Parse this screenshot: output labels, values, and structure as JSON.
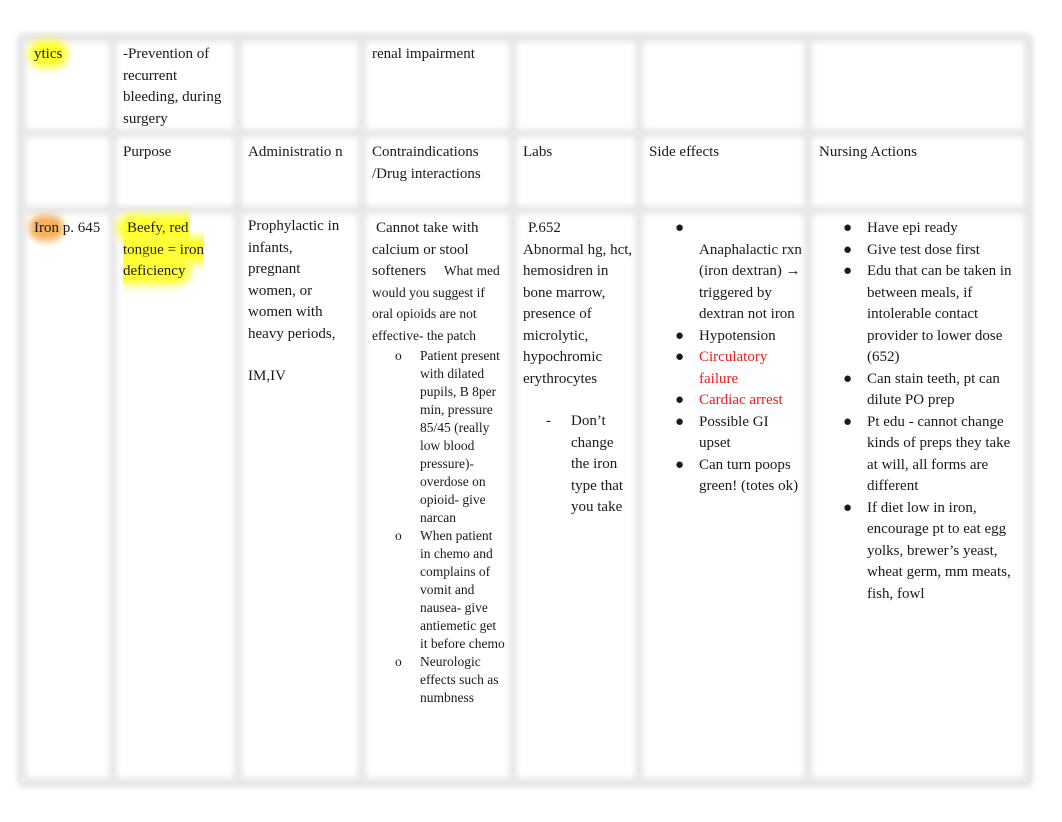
{
  "row_prev": {
    "drug": "ytics",
    "purpose": "-Prevention of recurrent bleeding, during surgery",
    "administration": "",
    "contraindications": "renal impairment",
    "labs": "",
    "side_effects": "",
    "nursing_actions": ""
  },
  "header": {
    "drug": "",
    "purpose": "Purpose",
    "administration": "Administratio n",
    "contraindications": "Contraindications /Drug interactions",
    "labs": "Labs",
    "side_effects": "Side effects",
    "nursing_actions": "Nursing Actions"
  },
  "iron_row": {
    "drug_name": "Iron",
    "drug_page": " p. 645",
    "purpose": "Beefy, red tongue =   iron deficiency",
    "administration": "Prophylactic in infants, pregnant women, or women with heavy periods,",
    "administration_route": "IM,IV",
    "contraindications_intro": "Cannot take with calcium or stool softeners",
    "contraindications_question": "What med would you suggest if oral opioids are not effective- the patch",
    "contraindications_subitems": [
      {
        "marker": "o",
        "text": "Patient present with dilated pupils, B 8per min, pressure 85/45 (really low blood pressure)- overdose on opioid- give narcan"
      },
      {
        "marker": "o",
        "text": "When patient in chemo and complains of vomit and nausea- give antiemetic get it before chemo"
      },
      {
        "marker": "o",
        "text": "Neurologic effects such as numbness"
      }
    ],
    "labs_page": "P.652",
    "labs": "Abnormal hg, hct, hemosidren in bone marrow, presence of microlytic, hypochromic erythrocytes",
    "labs_subitems": [
      {
        "marker": "-",
        "text": "Don’t change the iron type that you take"
      }
    ],
    "side_effects": [
      {
        "marker": "●",
        "text": "",
        "color": "#1a1a1a"
      },
      {
        "marker": "",
        "text": "Anaphalactic rxn (iron dextran) → triggered by dextran not iron",
        "color": "#1a1a1a"
      },
      {
        "marker": "●",
        "text": "Hypotension",
        "color": "#1a1a1a"
      },
      {
        "marker": "●",
        "text": "Circulatory failure",
        "color": "#ee1c1c"
      },
      {
        "marker": "●",
        "text": "Cardiac arrest",
        "color": "#ee1c1c"
      },
      {
        "marker": "●",
        "text": "Possible GI upset",
        "color": "#1a1a1a"
      },
      {
        "marker": "●",
        "text": "Can turn poops green! (totes ok)",
        "color": "#1a1a1a"
      }
    ],
    "nursing_actions": [
      {
        "marker": "●",
        "text": " Have epi ready"
      },
      {
        "marker": "●",
        "text": "Give test dose first"
      },
      {
        "marker": "●",
        "text": "Edu that can be taken in between meals, if intolerable contact provider to lower dose (652)"
      },
      {
        "marker": "●",
        "text": "Can stain teeth, pt can dilute PO prep"
      },
      {
        "marker": "●",
        "text": "Pt edu - cannot change kinds of preps they take at will, all forms are different"
      },
      {
        "marker": "●",
        "text": "If diet low in iron, encourage pt to eat egg yolks, brewer’s yeast, wheat germ, mm meats, fish, fowl"
      }
    ]
  },
  "colors": {
    "highlight_yellow": "#ffff33",
    "highlight_orange": "#f4b25e",
    "alert_red": "#ee1c1c",
    "grid_gray": "#e6e6e6"
  }
}
